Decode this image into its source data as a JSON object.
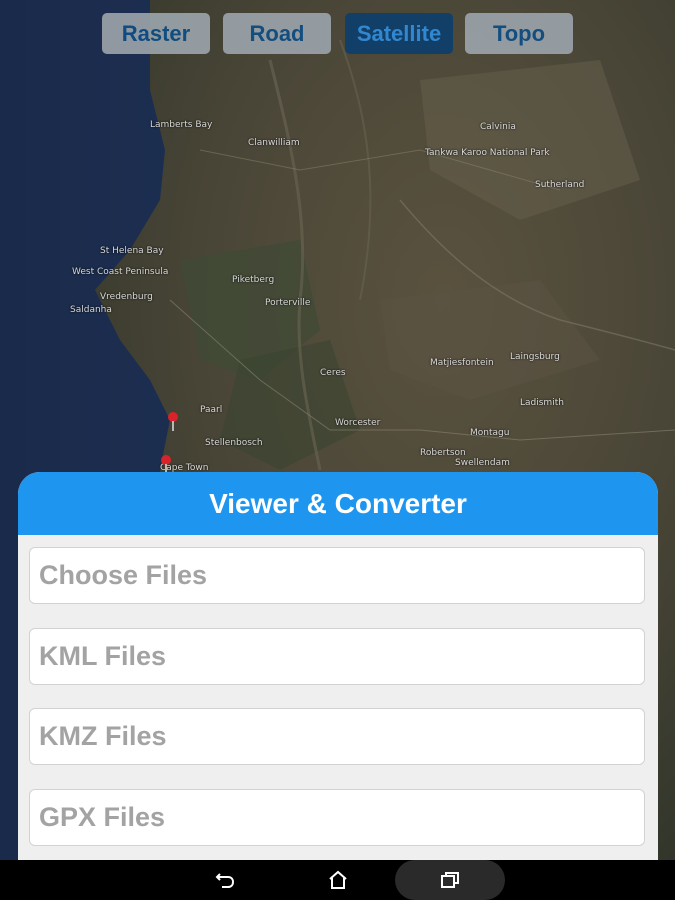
{
  "map_types": [
    {
      "label": "Raster",
      "active": false
    },
    {
      "label": "Road",
      "active": false
    },
    {
      "label": "Satellite",
      "active": true
    },
    {
      "label": "Topo",
      "active": false
    }
  ],
  "map_labels": [
    "Lamberts Bay",
    "Clanwilliam",
    "Tankwa Karoo National Park",
    "Sutherland",
    "Calvinia",
    "St Helena Bay",
    "West Coast Peninsula",
    "Vredenburg",
    "Saldanha",
    "Piketberg",
    "Porterville",
    "Ceres",
    "Worcester",
    "Laingsburg",
    "Matjiesfontein",
    "Paarl",
    "Stellenbosch",
    "Robertson",
    "Montagu",
    "Ladismith",
    "Cape Town",
    "Swellendam"
  ],
  "panel": {
    "title": "Viewer & Converter",
    "buttons": [
      "Choose Files",
      "KML Files",
      "KMZ Files",
      "GPX Files"
    ]
  },
  "navbar": {
    "back_icon": "back-arrow-icon",
    "home_icon": "home-icon",
    "recents_icon": "recent-apps-icon"
  },
  "colors": {
    "header_blue": "#1e96f0",
    "active_maptype_bg": "#0d3f6b",
    "maptype_text": "#0f4f86"
  }
}
